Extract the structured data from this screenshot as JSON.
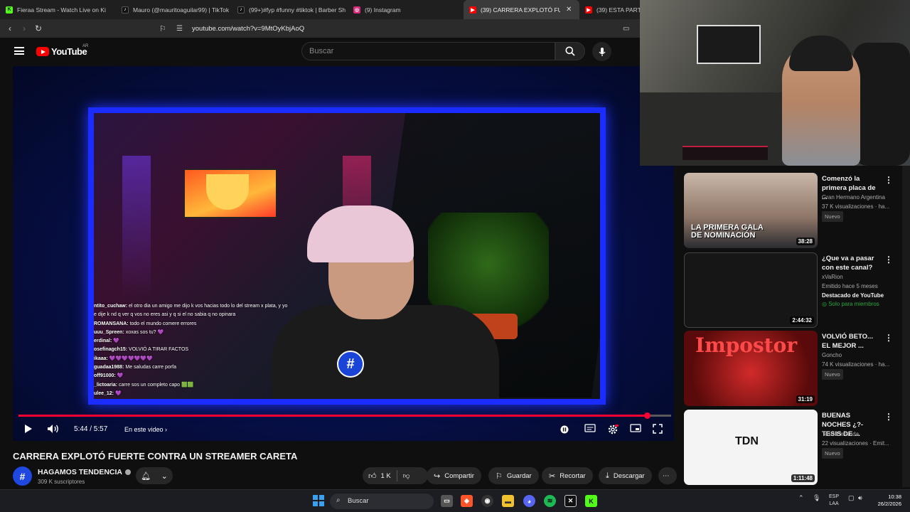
{
  "browser": {
    "tabs": [
      {
        "title": "Fieraa Stream - Watch Live on Ki",
        "icon": "kick-icon",
        "color": "#53fc18",
        "active": false
      },
      {
        "title": "Mauro (@mauritoaguilar99) | TikTok",
        "icon": "tiktok-icon",
        "color": "#111111",
        "active": false
      },
      {
        "title": "(99+)#fyp #funny #tiktok | Barber Sh",
        "icon": "tiktok-icon",
        "color": "#111111",
        "active": false
      },
      {
        "title": "(9) Instagram",
        "icon": "instagram-icon",
        "color": "#d62976",
        "active": false
      },
      {
        "title": "(39) CARRERA EXPLOTÓ FUERTE",
        "icon": "youtube-icon",
        "color": "#ff0000",
        "active": true
      },
      {
        "title": "(39) ESTA PARTI",
        "icon": "youtube-icon",
        "color": "#ff0000",
        "active": false
      }
    ],
    "url": "youtube.com/watch?v=9MtOyKbjAoQ"
  },
  "youtube": {
    "wordmark": "YouTube",
    "country": "AR",
    "search_placeholder": "Buscar"
  },
  "player": {
    "current_time": "5:44",
    "duration": "5:57",
    "time_display": "5:44 / 5:57",
    "chapter_label": "En este video",
    "progress": 0.963,
    "chat": [
      {
        "user": "ntito_cuchaw:",
        "text": "el otro dia un amigo me dijo k vos hacias todo lo del stream x plata, y yo"
      },
      {
        "user": "",
        "text": "e dije k nd q ver q vos no eres asi y q si el no sabia q no opinara"
      },
      {
        "user": "ROMANSANA:",
        "text": "todo el mundo comere errores"
      },
      {
        "user": "uuu_Spreen:",
        "text": "xoxas sos tu? 💜"
      },
      {
        "user": "erdinal:",
        "text": "💜"
      },
      {
        "user": "osefinagch15:",
        "text": "VOLVIÓ A TIRAR FACTOS"
      },
      {
        "user": "ikaaa:",
        "text": "💜💜💜💜💜💜💜"
      },
      {
        "user": "guadaa1988:",
        "text": "Me saludas carre porfa"
      },
      {
        "user": "off91000:",
        "text": "💜"
      },
      {
        "user": "_lictoaria:",
        "text": "carre sos un completo capo 🟩🟩"
      },
      {
        "user": "ulee_12:",
        "text": "💜"
      }
    ]
  },
  "video": {
    "title": "CARRERA EXPLOTÓ FUERTE CONTRA UN STREAMER CARETA",
    "channel_name": "HAGAMOS TENDENCIA",
    "channel_avatar_letter": "#",
    "subscribers": "309 K suscriptores",
    "likes": "1 K",
    "share_label": "Compartir",
    "save_label": "Guardar",
    "clip_label": "Recortar",
    "download_label": "Descargar"
  },
  "recommendations": [
    {
      "title": "Comenzó la primera placa de ...",
      "channel": "Gran Hermano Argentina",
      "meta": "37 K visualizaciones · ha...",
      "badge": "Nuevo",
      "duration": "38:28",
      "thumb_caption_1": "LA PRIMERA GALA",
      "thumb_caption_2": "DE NOMINACIÓN"
    },
    {
      "title": "¿Que va a pasar con este canal?",
      "channel": "xVaRion",
      "meta": "Emitido hace 5 meses",
      "extra": "Destacado de YouTube",
      "members": "Solo para miembros",
      "duration": "2:44:32"
    },
    {
      "title": "VOLVIÓ BETO... EL MEJOR ...",
      "channel": "Goncho",
      "meta": "74 K visualizaciones · ha...",
      "badge": "Nuevo",
      "duration": "31:19",
      "thumb_text": "Impostor"
    },
    {
      "title": "BUENAS NOCHES ¿?- TESIS DE ...",
      "channel": "Tesis De Nada",
      "meta": "22 visualizaciones · Emit...",
      "badge": "Nuevo",
      "duration": "1:11:48",
      "thumb_text": "TDN"
    }
  ],
  "taskbar": {
    "search_label": "Buscar",
    "lang_1": "ESP",
    "lang_2": "LAA",
    "time": "10:38",
    "date": "26/2/2026"
  }
}
